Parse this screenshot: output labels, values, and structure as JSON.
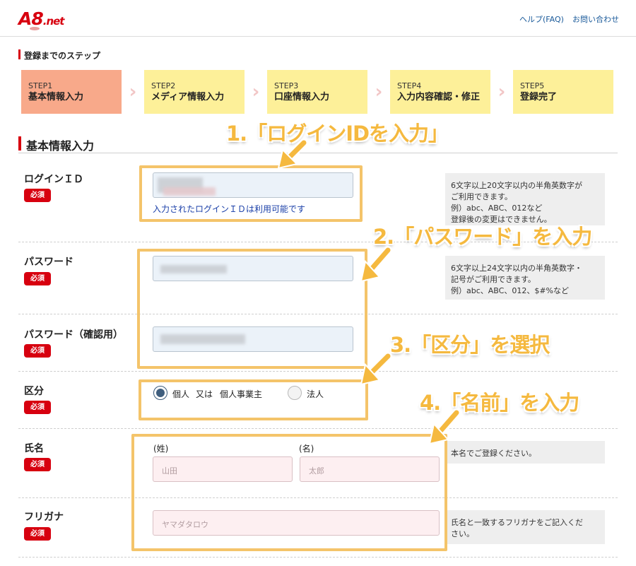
{
  "header": {
    "logo_main": "A8",
    "logo_suffix": ".net",
    "links": [
      "ヘルプ(FAQ)",
      "お問い合わせ"
    ]
  },
  "steps_section": {
    "title": "登録までのステップ",
    "steps": [
      {
        "num": "STEP1",
        "label": "基本情報入力",
        "active": true
      },
      {
        "num": "STEP2",
        "label": "メディア情報入力",
        "active": false
      },
      {
        "num": "STEP3",
        "label": "口座情報入力",
        "active": false
      },
      {
        "num": "STEP4",
        "label": "入力内容確認・修正",
        "active": false
      },
      {
        "num": "STEP5",
        "label": "登録完了",
        "active": false
      }
    ],
    "arrow_glyph": "›"
  },
  "form": {
    "title": "基本情報入力",
    "required_badge": "必須",
    "login_id": {
      "label": "ログインＩＤ",
      "status": "入力されたログインＩＤは利用可能です",
      "note": "6文字以上20文字以内の半角英数字が\nご利用できます。\n例）abc、ABC、012など\n登録後の変更はできません。"
    },
    "password": {
      "label": "パスワード",
      "note": "6文字以上24文字以内の半角英数字・\n記号がご利用できます。\n例）abc、ABC、012、$#%など"
    },
    "password_confirm": {
      "label": "パスワード（確認用）"
    },
    "category": {
      "label": "区分",
      "option1": "個人",
      "option1_suffix": "又は",
      "option1_detail": "個人事業主",
      "option2": "法人",
      "selected": "個人"
    },
    "name": {
      "label": "氏名",
      "sei_label": "(姓)",
      "mei_label": "(名)",
      "sei_placeholder": "山田",
      "mei_placeholder": "太郎",
      "note": "本名でご登録ください。"
    },
    "furigana": {
      "label": "フリガナ",
      "placeholder": "ヤマダタロウ",
      "note": "氏名と一致するフリガナをご記入くだ\nさい。"
    }
  },
  "annotations": {
    "a1": "1.「ログインIDを入力」",
    "a2": "2.「パスワード」を入力",
    "a3": "3.「区分」を選択",
    "a4": "4.「名前」を入力",
    "color": "#f5b93f"
  },
  "colors": {
    "brand_red": "#d7000f",
    "step_active": "#f8a98a",
    "step_inactive": "#fdf099",
    "link": "#1a5a9a"
  }
}
